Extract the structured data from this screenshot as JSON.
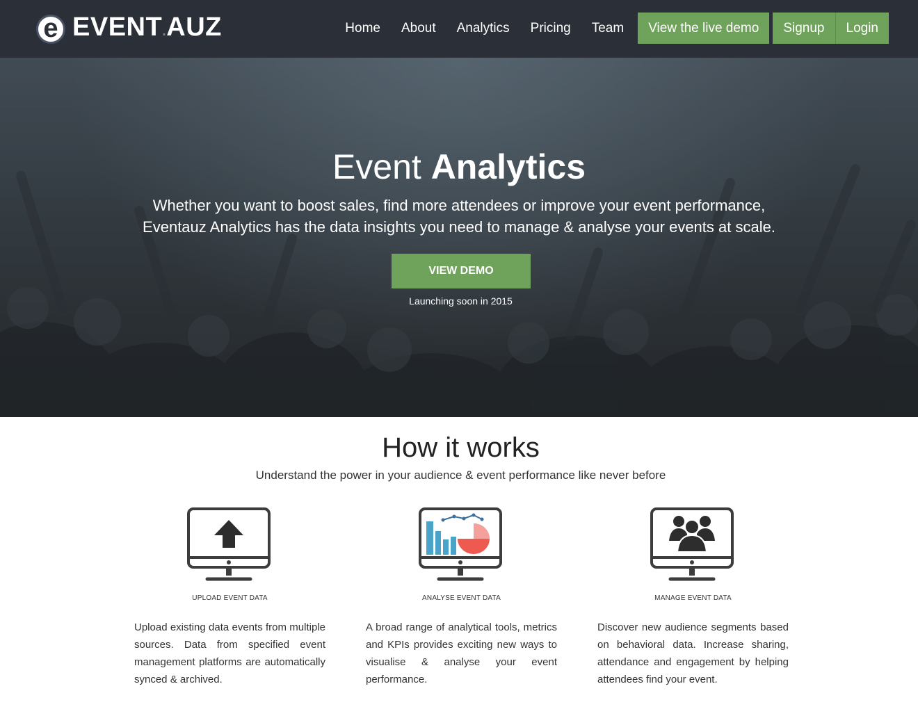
{
  "brand": {
    "logo_letter": "e",
    "name_part1": "EVENT",
    "name_dot": ".",
    "name_part2": "AUZ"
  },
  "nav": {
    "links": [
      "Home",
      "About",
      "Analytics",
      "Pricing",
      "Team"
    ],
    "live_demo": "View the live demo",
    "signup": "Signup",
    "login": "Login"
  },
  "hero": {
    "title_light": "Event ",
    "title_bold": "Analytics",
    "subtitle": "Whether you want to boost sales, find more attendees or improve your event performance, Eventauz Analytics has the data insights you need to manage & analyse your events at scale.",
    "cta": "VIEW DEMO",
    "note": "Launching soon in 2015"
  },
  "how": {
    "title": "How it works",
    "subtitle": "Understand the power in your audience & event performance like never before",
    "features": [
      {
        "icon": "upload-monitor-icon",
        "caption": "UPLOAD EVENT DATA",
        "desc": "Upload existing data events from multiple sources. Data from specified event management platforms are automatically synced & archived."
      },
      {
        "icon": "analytics-monitor-icon",
        "caption": "ANALYSE EVENT DATA",
        "desc": "A broad range of analytical tools, metrics and KPIs provides exciting new ways to visualise & analyse your event performance."
      },
      {
        "icon": "audience-monitor-icon",
        "caption": "MANAGE EVENT DATA",
        "desc": "Discover new audience segments based on behavioral data. Increase sharing, attendance and engagement by helping attendees find your event."
      }
    ]
  },
  "colors": {
    "navbar_bg": "#2b2f38",
    "accent_green": "#6fa25a",
    "chart_blue": "#4aa3c8",
    "chart_red": "#ef5a50"
  }
}
